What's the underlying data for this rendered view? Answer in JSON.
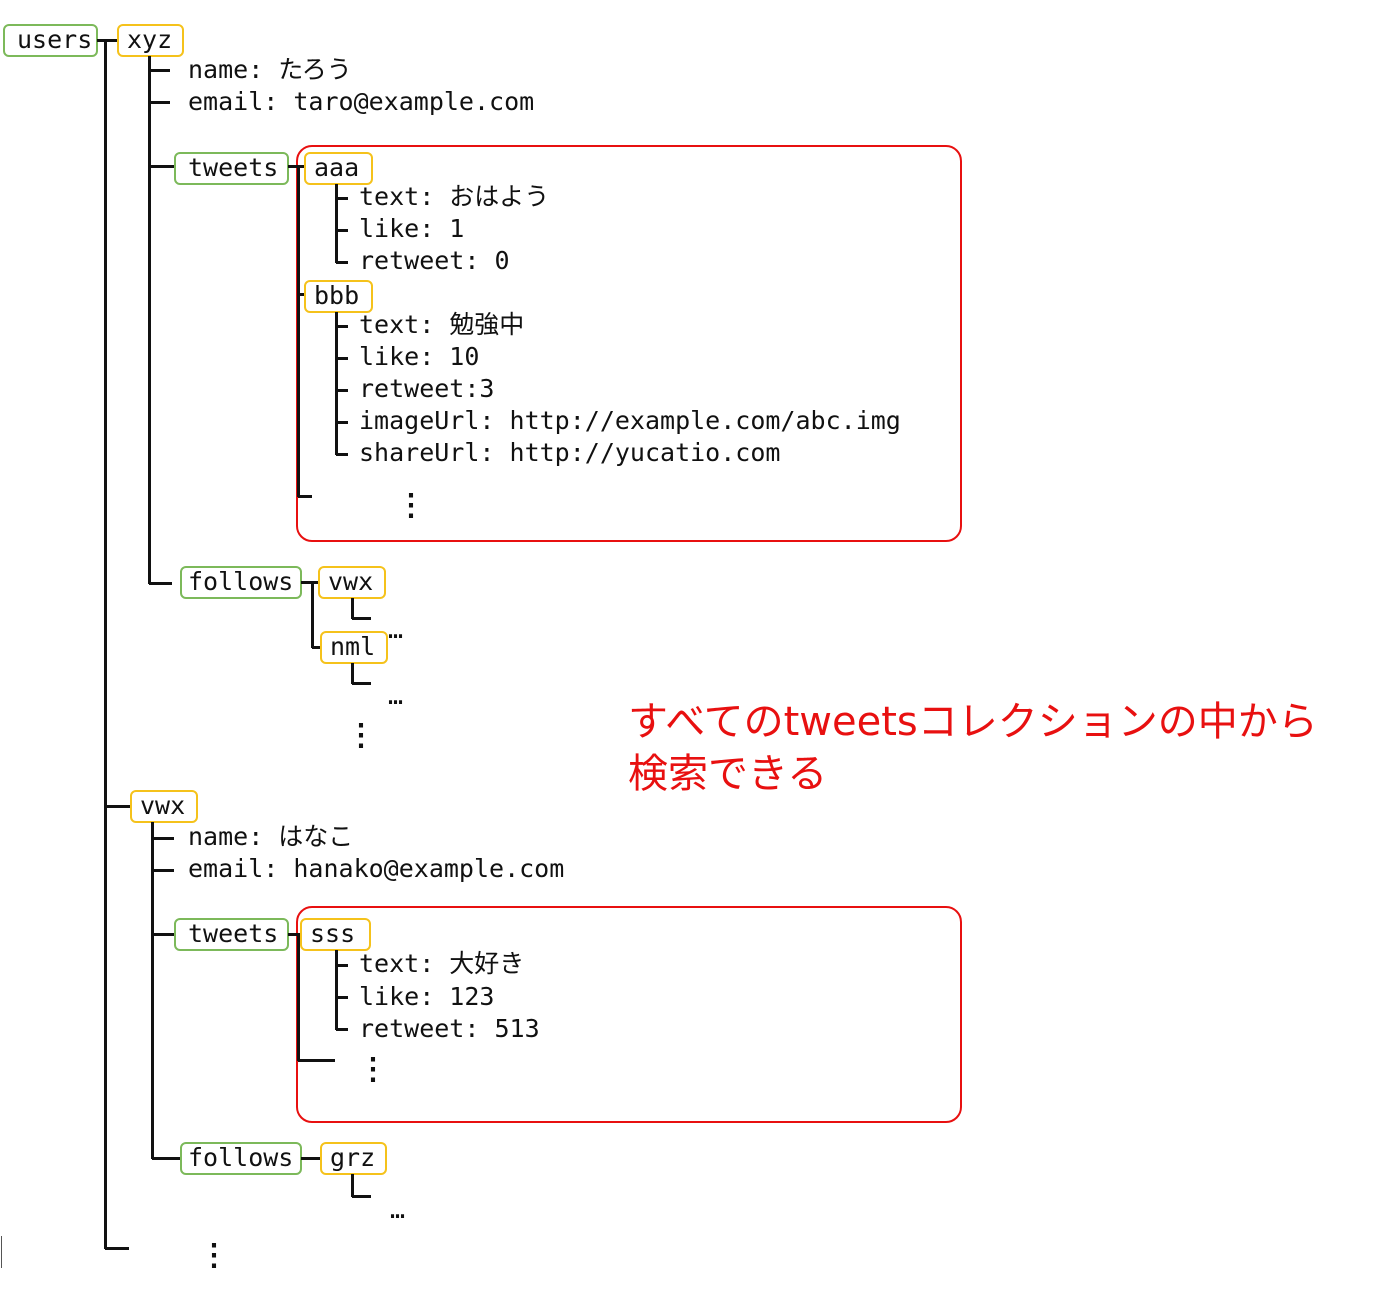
{
  "root": "users",
  "users": [
    {
      "id": "xyz",
      "fields": [
        "name: たろう",
        "email: taro@example.com"
      ],
      "tweets_label": "tweets",
      "tweets": [
        {
          "id": "aaa",
          "fields": [
            "text: おはよう",
            "like: 1",
            "retweet: 0"
          ]
        },
        {
          "id": "bbb",
          "fields": [
            "text: 勉強中",
            "like: 10",
            "retweet:3",
            "imageUrl: http://example.com/abc.img",
            "shareUrl: http://yucatio.com"
          ]
        }
      ],
      "follows_label": "follows",
      "follows": [
        "vwx",
        "nml"
      ]
    },
    {
      "id": "vwx",
      "fields": [
        "name: はなこ",
        "email: hanako@example.com"
      ],
      "tweets_label": "tweets",
      "tweets": [
        {
          "id": "sss",
          "fields": [
            "text: 大好き",
            "like: 123",
            "retweet: 513"
          ]
        }
      ],
      "follows_label": "follows",
      "follows": [
        "grz"
      ]
    }
  ],
  "ellipsis": "…",
  "vellipsis": "⋮",
  "note": {
    "line1": "すべてのtweetsコレクションの中から",
    "line2": "検索できる",
    "color": "#e81010"
  },
  "colors": {
    "collection": "#7cb95a",
    "document": "#f5c21b",
    "highlight": "#e81010"
  }
}
